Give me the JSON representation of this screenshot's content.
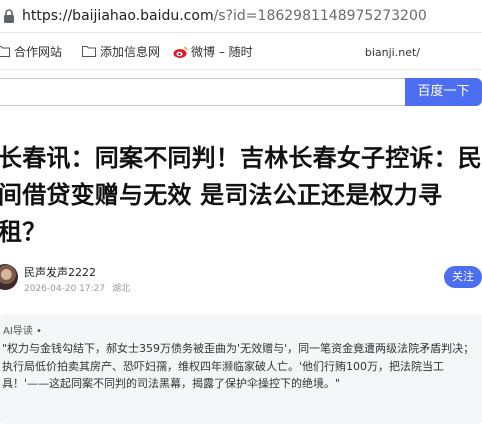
{
  "browser": {
    "url_host": "https://baijiahao.baidu.com",
    "url_rest": "/s?id=1862981148975273200"
  },
  "bookmarks": [
    {
      "label": "合作网站",
      "icon": "folder-icon"
    },
    {
      "label": "添加信息网",
      "icon": "folder-icon"
    },
    {
      "label": "微博 – 随时",
      "icon": "weibo-icon"
    }
  ],
  "bookmarks_right": "bianji.net/",
  "search": {
    "value": "",
    "button_label": "百度一下",
    "accent": "#4e6ef2"
  },
  "article": {
    "title": "长春讯：同案不同判！吉林长春女子控诉：民间借贷变赠与无效 是司法公正还是权力寻租？",
    "author": "民声发声2222",
    "date": "2026-04-20 17:27",
    "location": "湖北",
    "follow_label": "关注"
  },
  "ai_summary": {
    "label": "AI导读 •",
    "text": "\"权力与金钱勾结下，郝女士359万债务被歪曲为'无效赠与'，同一笔资金竟遭两级法院矛盾判决；执行局低价拍卖其房产、恐吓妇孺，维权四年濒临家破人亡。'他们行贿100万，把法院当工具！'——这起同案不同判的司法黑幕，揭露了保护伞操控下的绝境。\""
  }
}
